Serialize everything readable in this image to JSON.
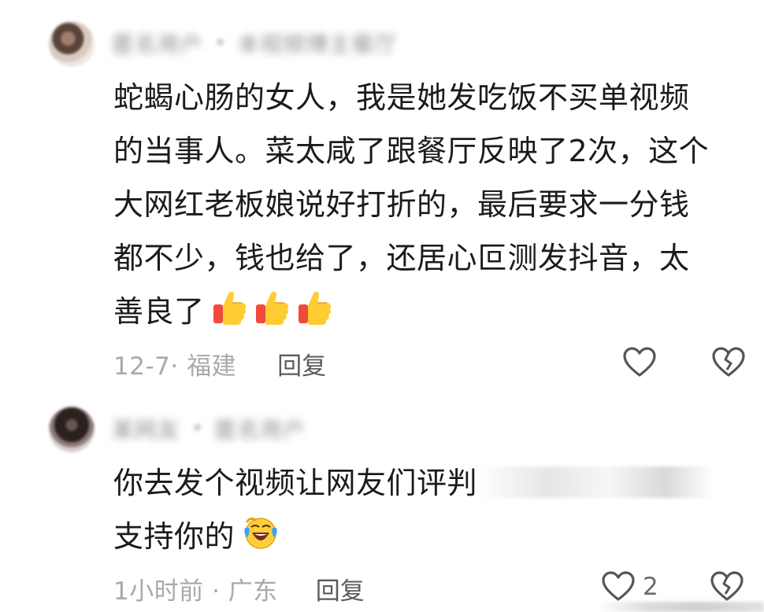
{
  "comments": [
    {
      "username": "匿名用户",
      "separator": "•",
      "reply_to": "本视频博主餐厅",
      "lines": [
        "蛇蝎心肠的女人，我是她发吃饭不买单视频",
        "的当事人。菜太咸了跟餐厅反映了2次，这个",
        "大网红老板娘说好打折的，最后要求一分钱",
        "都不少，钱也给了，还居心叵测发抖音，太",
        "善良了"
      ],
      "emojis": [
        "thumbs-up-icon",
        "thumbs-up-icon",
        "thumbs-up-icon"
      ],
      "time_location": "12-7· 福建",
      "reply_label": "回复",
      "like_count": ""
    },
    {
      "username": "某网友",
      "separator": "•",
      "reply_to": "匿名用户",
      "lines": [
        "你去发个视频让网友们评判",
        "支持你的"
      ],
      "emojis": [
        "laughing-crying-icon"
      ],
      "time_location": "1小时前 · 广东",
      "reply_label": "回复",
      "like_count": "2"
    }
  ]
}
